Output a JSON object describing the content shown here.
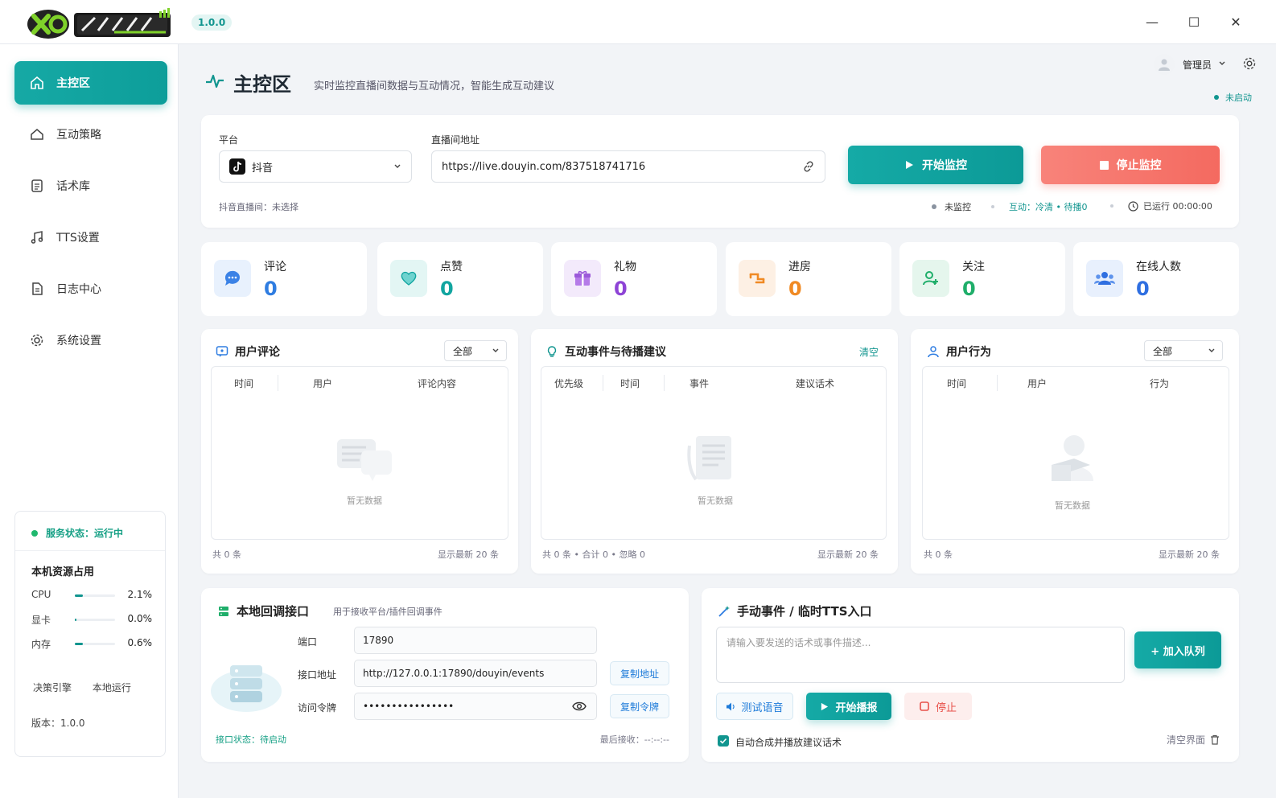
{
  "app": {
    "version": "1.0.0"
  },
  "window": {
    "minimize": "—",
    "maximize": "☐",
    "close": "✕"
  },
  "sidebar": {
    "items": [
      {
        "label": "主控区",
        "icon": "home-icon"
      },
      {
        "label": "互动策略",
        "icon": "strategy-icon"
      },
      {
        "label": "话术库",
        "icon": "book-icon"
      },
      {
        "label": "TTS设置",
        "icon": "music-icon"
      },
      {
        "label": "日志中心",
        "icon": "log-icon"
      },
      {
        "label": "系统设置",
        "icon": "gear-icon"
      }
    ],
    "status": {
      "service": "服务状态：运行中",
      "resources_title": "本机资源占用",
      "rows": [
        {
          "label": "CPU",
          "value": "2.1%",
          "level": 0.021
        },
        {
          "label": "显卡",
          "value": "0.0%",
          "level": 0.0
        },
        {
          "label": "内存",
          "value": "0.6%",
          "level": 0.006
        }
      ],
      "engine_label": "决策引擎",
      "engine_value": "本地运行",
      "version": "版本：1.0.0"
    }
  },
  "header": {
    "title": "主控区",
    "subtitle": "实时监控直播间数据与互动情况，智能生成互动建议",
    "user": "管理员",
    "status": "未启动"
  },
  "monitor": {
    "platform_label": "平台",
    "platform_value": "抖音",
    "url_label": "直播间地址",
    "url_value": "https://live.douyin.com/837518741716",
    "start_btn": "开始监控",
    "stop_btn": "停止监控",
    "room_hint": "抖音直播间：未选择",
    "state": "未监控",
    "interaction": "互动：冷清 • 待播0",
    "runtime": "已运行 00:00:00"
  },
  "stats": [
    {
      "name": "评论",
      "value": "0",
      "color": "#2f7de1",
      "icon": "comment-icon"
    },
    {
      "name": "点赞",
      "value": "0",
      "color": "#12a5a0",
      "icon": "heart-icon"
    },
    {
      "name": "礼物",
      "value": "0",
      "color": "#8e44d6",
      "icon": "gift-icon"
    },
    {
      "name": "进房",
      "value": "0",
      "color": "#f08a24",
      "icon": "enter-icon"
    },
    {
      "name": "关注",
      "value": "0",
      "color": "#1fae6a",
      "icon": "follow-icon"
    },
    {
      "name": "在线人数",
      "value": "0",
      "color": "#2f6fe1",
      "icon": "users-icon"
    }
  ],
  "comments": {
    "title": "用户评论",
    "filter": "全部",
    "columns": [
      "时间",
      "用户",
      "评论内容"
    ],
    "empty": "暂无数据",
    "total": "共 0 条",
    "latest": "显示最新 20 条"
  },
  "events": {
    "title": "互动事件与待播建议",
    "clear": "清空",
    "columns": [
      "优先级",
      "时间",
      "事件",
      "建议话术"
    ],
    "empty": "暂无数据",
    "total": "共 0 条 • 合计 0 • 忽略 0",
    "latest": "显示最新 20 条"
  },
  "behavior": {
    "title": "用户行为",
    "filter": "全部",
    "columns": [
      "时间",
      "用户",
      "行为"
    ],
    "empty": "暂无数据",
    "total": "共 0 条",
    "latest": "显示最新 20 条"
  },
  "callback": {
    "title": "本地回调接口",
    "subtitle": "用于接收平台/插件回调事件",
    "port_label": "端口",
    "port_value": "17890",
    "addr_label": "接口地址",
    "addr_value": "http://127.0.0.1:17890/douyin/events",
    "copy_addr": "复制地址",
    "token_label": "访问令牌",
    "token_value": "••••••••••••••••",
    "copy_token": "复制令牌",
    "status": "接口状态：待启动",
    "last_recv": "最后接收：--:--:--"
  },
  "manual": {
    "title": "手动事件 / 临时TTS入口",
    "placeholder": "请输入要发送的话术或事件描述...",
    "enqueue": "+ 加入队列",
    "test_voice": "测试语音",
    "start_play": "开始播报",
    "stop": "停止",
    "auto_label": "自动合成并播放建议话术",
    "clear_screen": "清空界面"
  }
}
